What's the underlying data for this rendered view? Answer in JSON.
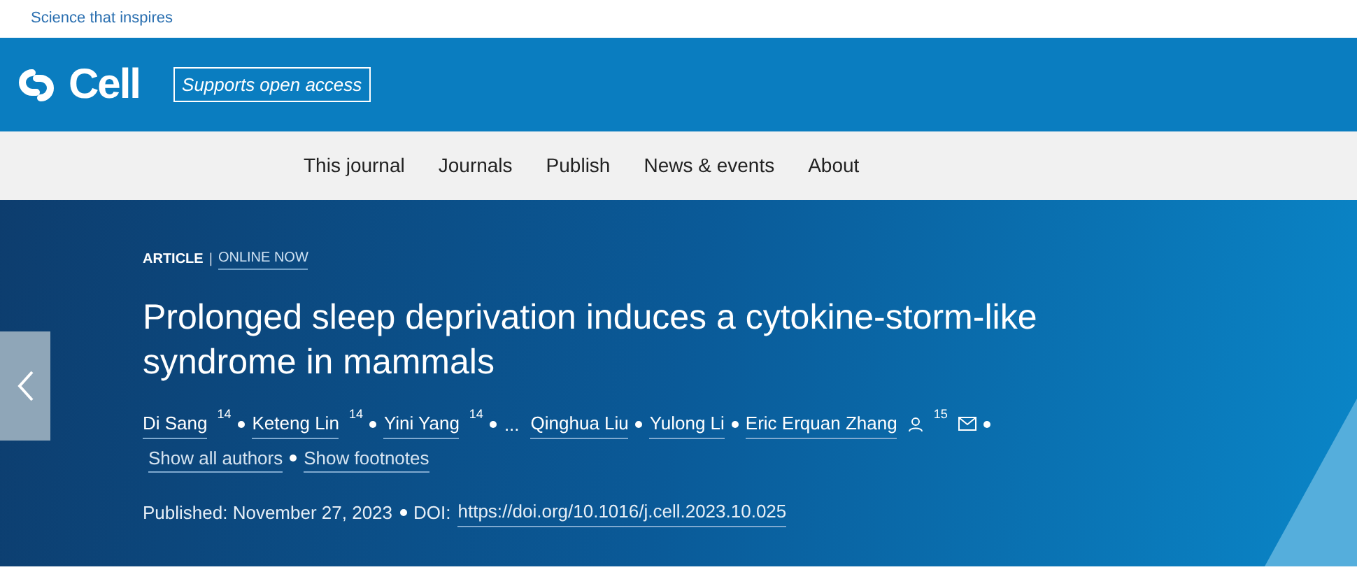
{
  "tagline": "Science that inspires",
  "brand": {
    "name": "Cell",
    "badge": "Supports open access"
  },
  "nav": [
    "This journal",
    "Journals",
    "Publish",
    "News & events",
    "About"
  ],
  "article": {
    "type": "ARTICLE",
    "status": "ONLINE NOW",
    "separator": "|",
    "title": "Prolonged sleep deprivation induces a cytokine-storm-like syndrome in mammals",
    "authors": [
      {
        "kind": "author",
        "name": "Di Sang",
        "note": "14"
      },
      {
        "kind": "author",
        "name": "Keteng Lin",
        "note": "14"
      },
      {
        "kind": "author",
        "name": "Yini Yang",
        "note": "14"
      },
      {
        "kind": "ellipsis",
        "name": "..."
      },
      {
        "kind": "author",
        "name": "Qinghua Liu"
      },
      {
        "kind": "author",
        "name": "Yulong Li"
      },
      {
        "kind": "corresponding",
        "name": "Eric Erquan Zhang",
        "note": "15"
      }
    ],
    "links": [
      "Show all authors",
      "Show footnotes"
    ],
    "published": "Published: November 27, 2023",
    "doi_label": "DOI:",
    "doi": "https://doi.org/10.1016/j.cell.2023.10.025"
  }
}
